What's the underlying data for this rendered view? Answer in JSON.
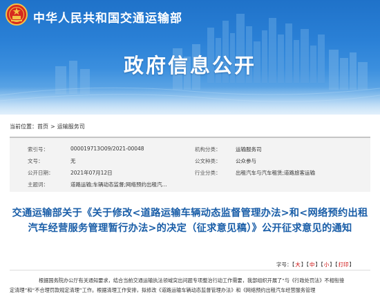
{
  "header": {
    "ministry_name": "中华人民共和国交通运输部",
    "banner_title": "政府信息公开",
    "emblem_icon": "national-emblem-icon",
    "colors": {
      "banner": "#2a80d6",
      "title_link": "#1a5ea8",
      "font_option": "#cc0000"
    }
  },
  "breadcrumb": {
    "prefix": "当前位置：",
    "home": "首页",
    "separator": ">",
    "current": "运输服务司"
  },
  "info": {
    "index_label": "索引号：",
    "index_value": "000019713O09/2021-00048",
    "org_label": "机构分类：",
    "org_value": "运输服务司",
    "docno_label": "文号：",
    "docno_value": "无",
    "audience_label": "公文种类：",
    "audience_value": "公众参与",
    "date_label": "公开日期：",
    "date_value": "2021年07月12日",
    "industry_label": "行业分类：",
    "industry_value": "出租汽车与汽车租赁;道路旅客运输",
    "subject_label": "主题词：",
    "subject_value": "道路运输;车辆动态监督;网络预约出租汽..."
  },
  "article": {
    "title": "交通运输部关于《关于修改<道路运输车辆动态监督管理办法>和<网络预约出租汽车经营服务管理暂行办法>的决定（征求意见稿）》公开征求意见的通知"
  },
  "font_controls": {
    "label": "字号：",
    "large": "大",
    "medium": "中",
    "small": "小",
    "print": "打印"
  },
  "body": {
    "line1": "根据国务院办公厅有关通知要求，结合当前交通运输执法领域突出问题专项整治行动工作需要，我部组织开展了“与《行政处罚法》不相衔接",
    "line2": "定清理”和“不合理罚款规定清理”工作。根据清理工作安排，拟修改《道路运输车辆动态监督管理办法》和《网络预约出租汽车经营服务管理"
  }
}
